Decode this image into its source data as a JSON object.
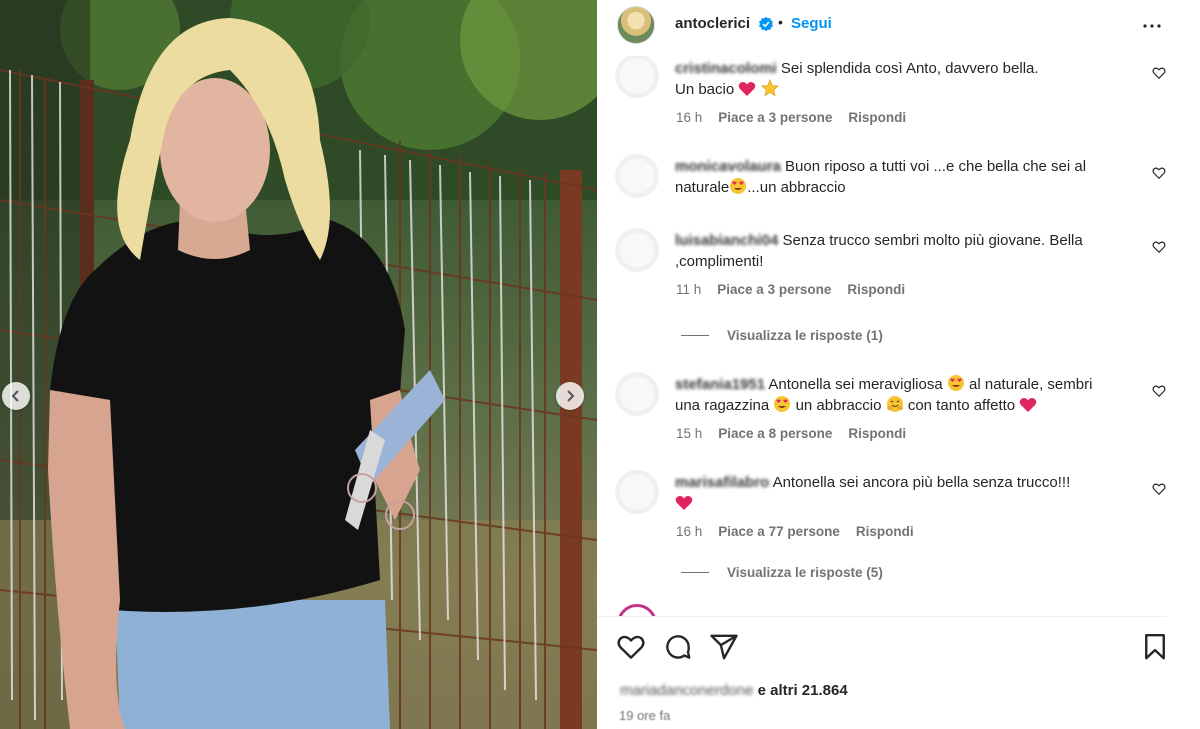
{
  "post": {
    "username": "antoclerici",
    "follow_label": "Segui",
    "separator": "•"
  },
  "comments": [
    {
      "user": "cristinacolomi",
      "text": "Sei splendida così Anto, davvero bella.",
      "text2": "Un bacio",
      "time": "16 h",
      "likes": "Piace a 3 persone",
      "reply": "Rispondi"
    },
    {
      "user": "monicavolaura",
      "text": "Buon riposo a tutti voi ...e che bella che sei al",
      "text2_pre": "naturale",
      "text2_post": "...un abbraccio"
    },
    {
      "user": "luisabianchi04",
      "text": "Senza trucco sembri molto più giovane. Bella",
      "text2": ",complimenti!",
      "time": "11 h",
      "likes": "Piace a 3 persone",
      "reply": "Rispondi"
    },
    {
      "user": "stefania1951",
      "text_a": "Antonella sei meravigliosa",
      "text_b": "al naturale, sembri",
      "text2_a": "una ragazzina",
      "text2_b": "un abbraccio",
      "text2_c": "con tanto affetto",
      "time": "15 h",
      "likes": "Piace a 8 persone",
      "reply": "Rispondi"
    },
    {
      "user": "marisafilabro",
      "text": "Antonella sei ancora più bella senza trucco!!!",
      "time": "16 h",
      "likes": "Piace a 77 persone",
      "reply": "Rispondi"
    }
  ],
  "view_replies": [
    "Visualizza le risposte (1)",
    "Visualizza le risposte (5)"
  ],
  "footer": {
    "liked_by_user": "mariadanconerdone",
    "liked_by_rest": "e altri 21.864",
    "time_ago": "19 ore fa"
  },
  "colors": {
    "accent": "#0095f6",
    "heart": "#e0245e",
    "text": "#262626",
    "muted": "#737373"
  },
  "icons": [
    "verified-icon",
    "more-options-icon",
    "heart-icon",
    "comment-icon",
    "share-icon",
    "save-icon",
    "chevron-left-icon",
    "chevron-right-icon"
  ]
}
